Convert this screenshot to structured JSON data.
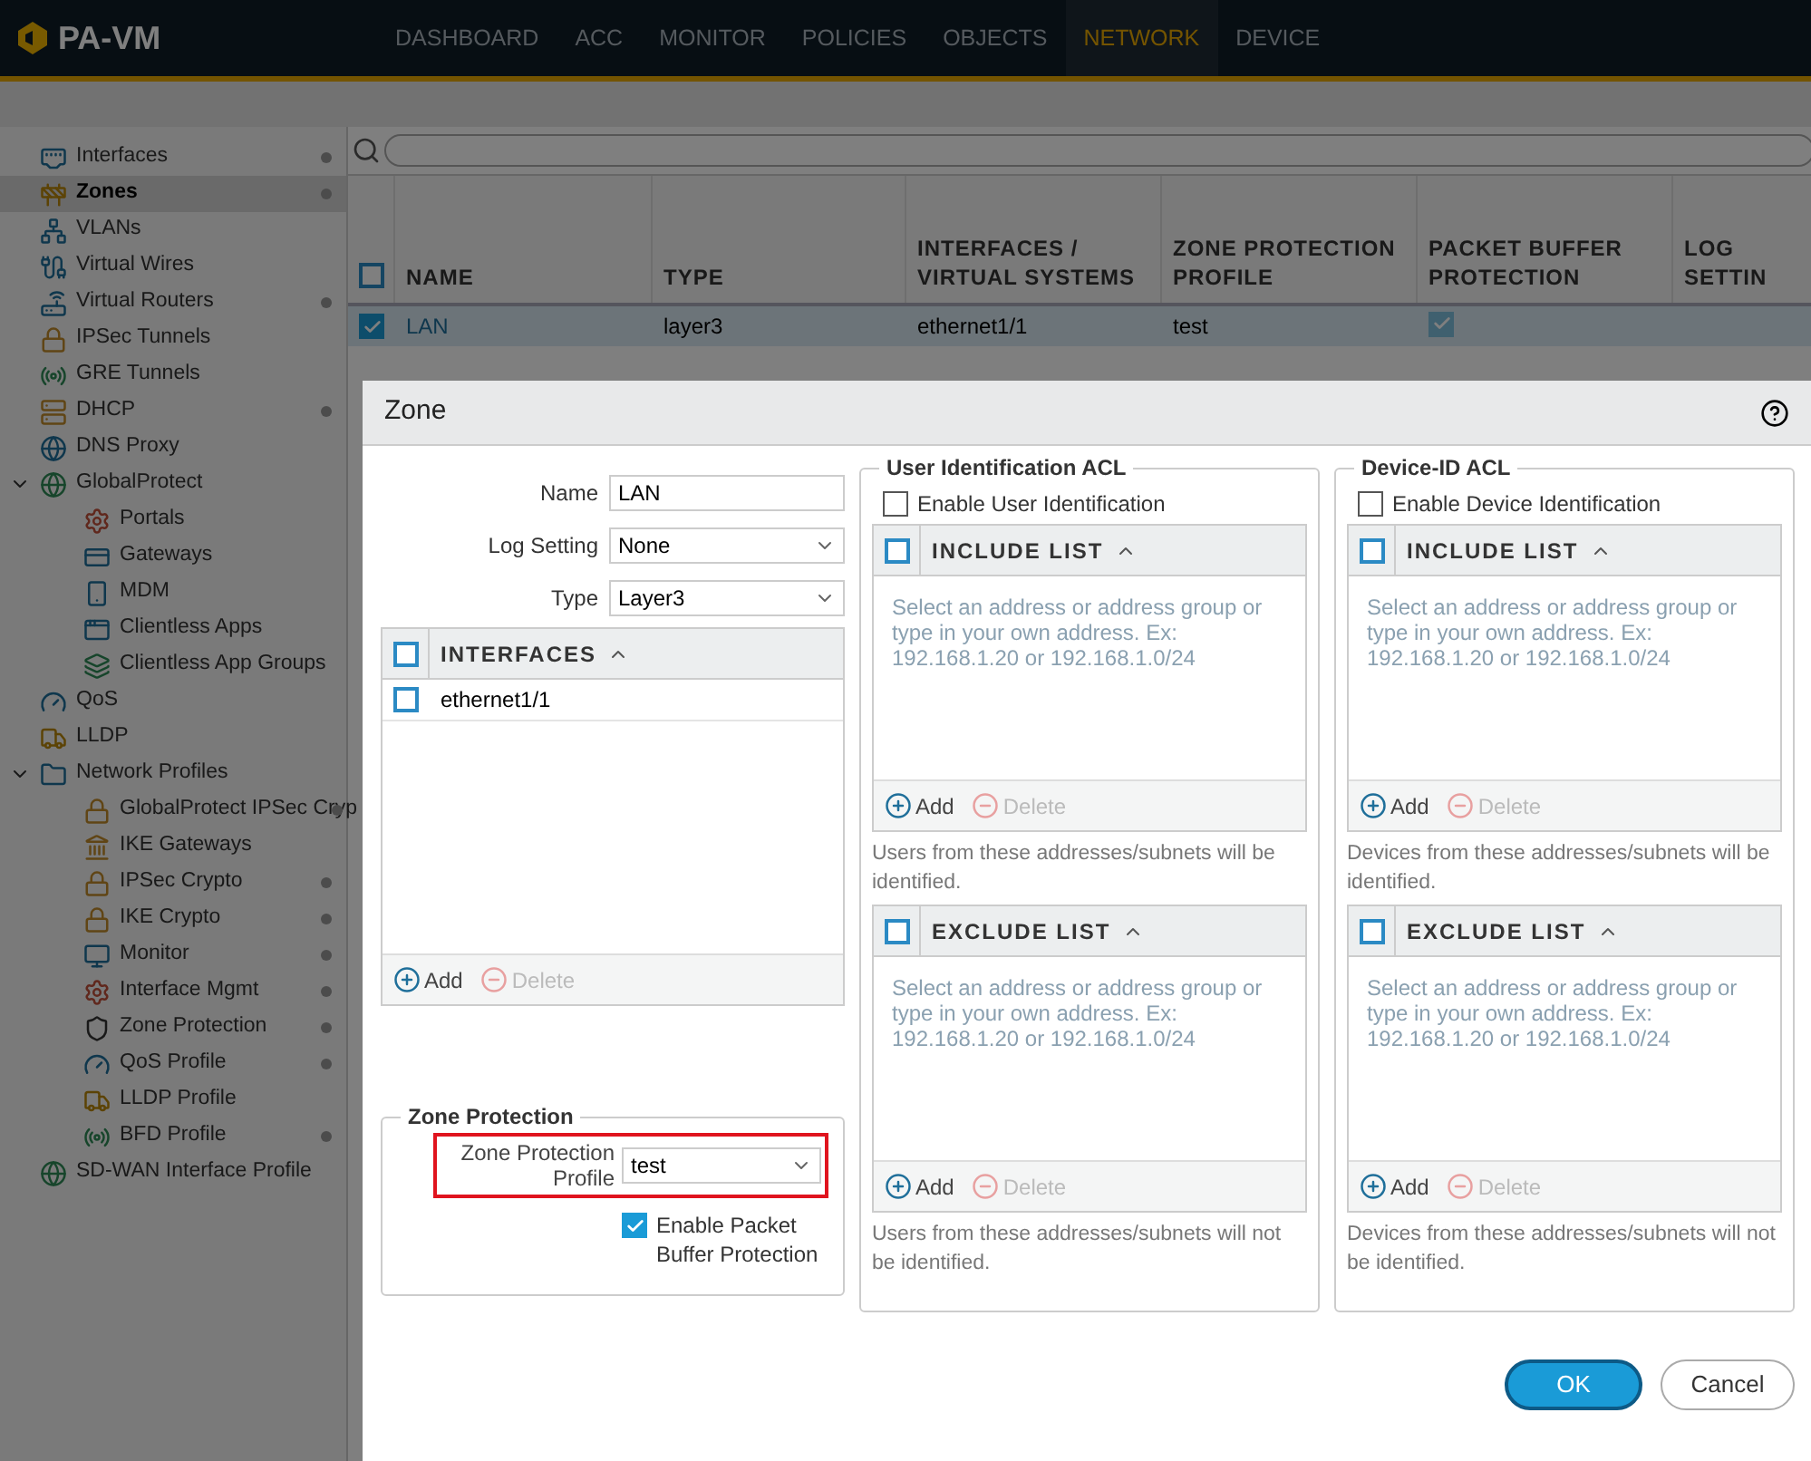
{
  "app": {
    "title": "PA-VM"
  },
  "tabs": [
    {
      "label": "DASHBOARD",
      "selected": false
    },
    {
      "label": "ACC",
      "selected": false
    },
    {
      "label": "MONITOR",
      "selected": false
    },
    {
      "label": "POLICIES",
      "selected": false
    },
    {
      "label": "OBJECTS",
      "selected": false
    },
    {
      "label": "NETWORK",
      "selected": true
    },
    {
      "label": "DEVICE",
      "selected": false
    }
  ],
  "sidebar": {
    "items": [
      {
        "label": "Interfaces",
        "selected": false,
        "dot": true
      },
      {
        "label": "Zones",
        "selected": true,
        "dot": true
      },
      {
        "label": "VLANs",
        "selected": false,
        "dot": false
      },
      {
        "label": "Virtual Wires",
        "selected": false,
        "dot": false
      },
      {
        "label": "Virtual Routers",
        "selected": false,
        "dot": true
      },
      {
        "label": "IPSec Tunnels",
        "selected": false,
        "dot": false
      },
      {
        "label": "GRE Tunnels",
        "selected": false,
        "dot": false
      },
      {
        "label": "DHCP",
        "selected": false,
        "dot": true
      },
      {
        "label": "DNS Proxy",
        "selected": false,
        "dot": false
      },
      {
        "label": "GlobalProtect",
        "selected": false,
        "dot": false,
        "expanded": true,
        "children": [
          {
            "label": "Portals",
            "selected": false,
            "dot": false
          },
          {
            "label": "Gateways",
            "selected": false,
            "dot": false
          },
          {
            "label": "MDM",
            "selected": false,
            "dot": false
          },
          {
            "label": "Clientless Apps",
            "selected": false,
            "dot": false
          },
          {
            "label": "Clientless App Groups",
            "selected": false,
            "dot": false
          }
        ]
      },
      {
        "label": "QoS",
        "selected": false,
        "dot": false
      },
      {
        "label": "LLDP",
        "selected": false,
        "dot": false
      },
      {
        "label": "Network Profiles",
        "selected": false,
        "dot": false,
        "expanded": true,
        "children": [
          {
            "label": "GlobalProtect IPSec Cryp",
            "selected": false,
            "dot": true
          },
          {
            "label": "IKE Gateways",
            "selected": false,
            "dot": false
          },
          {
            "label": "IPSec Crypto",
            "selected": false,
            "dot": true
          },
          {
            "label": "IKE Crypto",
            "selected": false,
            "dot": true
          },
          {
            "label": "Monitor",
            "selected": false,
            "dot": true
          },
          {
            "label": "Interface Mgmt",
            "selected": false,
            "dot": true
          },
          {
            "label": "Zone Protection",
            "selected": false,
            "dot": true
          },
          {
            "label": "QoS Profile",
            "selected": false,
            "dot": true
          },
          {
            "label": "LLDP Profile",
            "selected": false,
            "dot": false
          },
          {
            "label": "BFD Profile",
            "selected": false,
            "dot": true
          }
        ]
      },
      {
        "label": "SD-WAN Interface Profile",
        "selected": false,
        "dot": false
      }
    ]
  },
  "table": {
    "all_checked": false,
    "columns": [
      "NAME",
      "TYPE",
      "INTERFACES / VIRTUAL SYSTEMS",
      "ZONE PROTECTION PROFILE",
      "PACKET BUFFER PROTECTION",
      "LOG SETTIN"
    ],
    "rows": [
      {
        "selected": true,
        "checked": true,
        "name": "LAN",
        "type": "layer3",
        "interfaces": "ethernet1/1",
        "zone_protection_profile": "test",
        "packet_buffer_protection": true
      }
    ]
  },
  "dialog": {
    "title": "Zone",
    "fields": [
      {
        "label": "Name",
        "value": "LAN",
        "kind": "text"
      },
      {
        "label": "Log Setting",
        "value": "None",
        "kind": "dropdown"
      },
      {
        "label": "Type",
        "value": "Layer3",
        "kind": "dropdown"
      }
    ],
    "interfaces": {
      "all_checked": false,
      "header": "INTERFACES",
      "rows": [
        {
          "name": "ethernet1/1",
          "checked": false
        }
      ],
      "add": "Add",
      "delete": "Delete",
      "delete_disabled": true
    },
    "zone_protection": {
      "title": "Zone Protection",
      "label": "Zone Protection Profile",
      "value": "test",
      "highlighted": true,
      "packet_buffer": {
        "label": "Enable Packet Buffer Protection",
        "checked": true
      }
    },
    "acls": [
      {
        "title": "User Identification ACL",
        "enable": {
          "label": "Enable User Identification",
          "checked": false
        },
        "lists": [
          {
            "all_checked": false,
            "header": "INCLUDE LIST",
            "placeholder": "Select an address or address group or type in your own address. Ex: 192.168.1.20 or 192.168.1.0/24",
            "add": "Add",
            "delete": "Delete",
            "note": "Users from these addresses/subnets will be identified."
          },
          {
            "all_checked": false,
            "header": "EXCLUDE LIST",
            "placeholder": "Select an address or address group or type in your own address. Ex: 192.168.1.20 or 192.168.1.0/24",
            "add": "Add",
            "delete": "Delete",
            "note": "Users from these addresses/subnets will not be identified."
          }
        ]
      },
      {
        "title": "Device-ID ACL",
        "enable": {
          "label": "Enable Device Identification",
          "checked": false
        },
        "lists": [
          {
            "all_checked": false,
            "header": "INCLUDE LIST",
            "placeholder": "Select an address or address group or type in your own address. Ex: 192.168.1.20 or 192.168.1.0/24",
            "add": "Add",
            "delete": "Delete",
            "note": "Devices from these addresses/subnets will be identified."
          },
          {
            "all_checked": false,
            "header": "EXCLUDE LIST",
            "placeholder": "Select an address or address group or type in your own address. Ex: 192.168.1.20 or 192.168.1.0/24",
            "add": "Add",
            "delete": "Delete",
            "note": "Devices from these addresses/subnets will not be identified."
          }
        ]
      }
    ],
    "buttons": [
      {
        "label": "OK",
        "kind": "primary"
      },
      {
        "label": "Cancel",
        "kind": "secondary"
      }
    ]
  }
}
